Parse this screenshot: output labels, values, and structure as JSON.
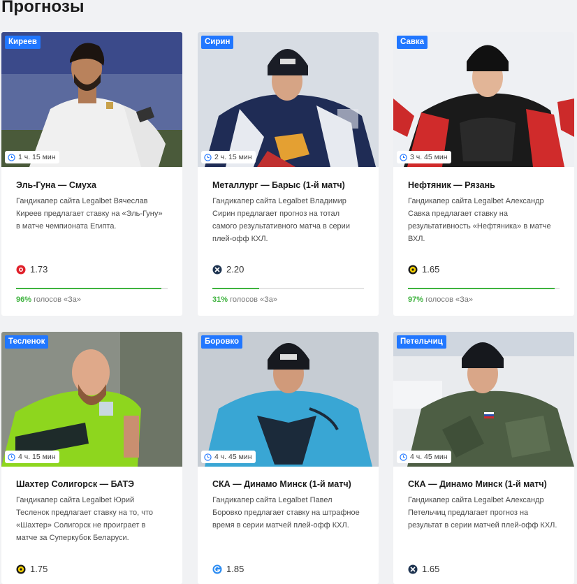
{
  "page_title": "Прогнозы",
  "colors": {
    "accent": "#2177ff",
    "vote": "#3fb33f"
  },
  "cards": [
    {
      "author": "Киреев",
      "time": "1 ч. 15 мин",
      "title": "Эль-Гуна — Смуха",
      "description": "Гандикапер сайта Legalbet Вячеслав Киреев предлагает ставку на «Эль-Гуну» в матче чемпионата Египта.",
      "bookmaker_icon": "red-ball-icon",
      "odds": "1.73",
      "vote_fraction": 0.96,
      "vote_pct": "96%",
      "vote_label": "голосов «За»"
    },
    {
      "author": "Сирин",
      "time": "2 ч. 15 мин",
      "title": "Металлург — Барыс (1-й матч)",
      "description": "Гандикапер сайта Legalbet Владимир Сирин предлагает прогноз на тотал самого результативного матча в серии плей-офф КХЛ.",
      "bookmaker_icon": "dark-bookmaker-icon",
      "odds": "2.20",
      "vote_fraction": 0.31,
      "vote_pct": "31%",
      "vote_label": "голосов «За»"
    },
    {
      "author": "Савка",
      "time": "3 ч. 45 мин",
      "title": "Нефтяник — Рязань",
      "description": "Гандикапер сайта Legalbet Александр Савка предлагает ставку на результативность «Нефтяника» в матче ВХЛ.",
      "bookmaker_icon": "yellow-bookmaker-icon",
      "odds": "1.65",
      "vote_fraction": 0.97,
      "vote_pct": "97%",
      "vote_label": "голосов «За»"
    },
    {
      "author": "Тесленок",
      "time": "4 ч. 15 мин",
      "title": "Шахтер Солигорск — БАТЭ",
      "description": "Гандикапер сайта Legalbet Юрий Тесленок предлагает ставку на то, что «Шахтер» Солигорск не проиграет в матче за Суперкубок Беларуси.",
      "bookmaker_icon": "yellow-bookmaker-icon",
      "odds": "1.75"
    },
    {
      "author": "Боровко",
      "time": "4 ч. 45 мин",
      "title": "СКА — Динамо Минск (1-й матч)",
      "description": "Гандикапер сайта Legalbet Павел Боровко предлагает ставку на штрафное время в серии матчей плей-офф КХЛ.",
      "bookmaker_icon": "blue-bookmaker-icon",
      "odds": "1.85"
    },
    {
      "author": "Петельчиц",
      "time": "4 ч. 45 мин",
      "title": "СКА — Динамо Минск (1-й матч)",
      "description": "Гандикапер сайта Legalbet Александр Петельчиц предлагает прогноз на результат в серии матчей плей-офф КХЛ.",
      "bookmaker_icon": "dark-bookmaker-icon",
      "odds": "1.65"
    }
  ]
}
